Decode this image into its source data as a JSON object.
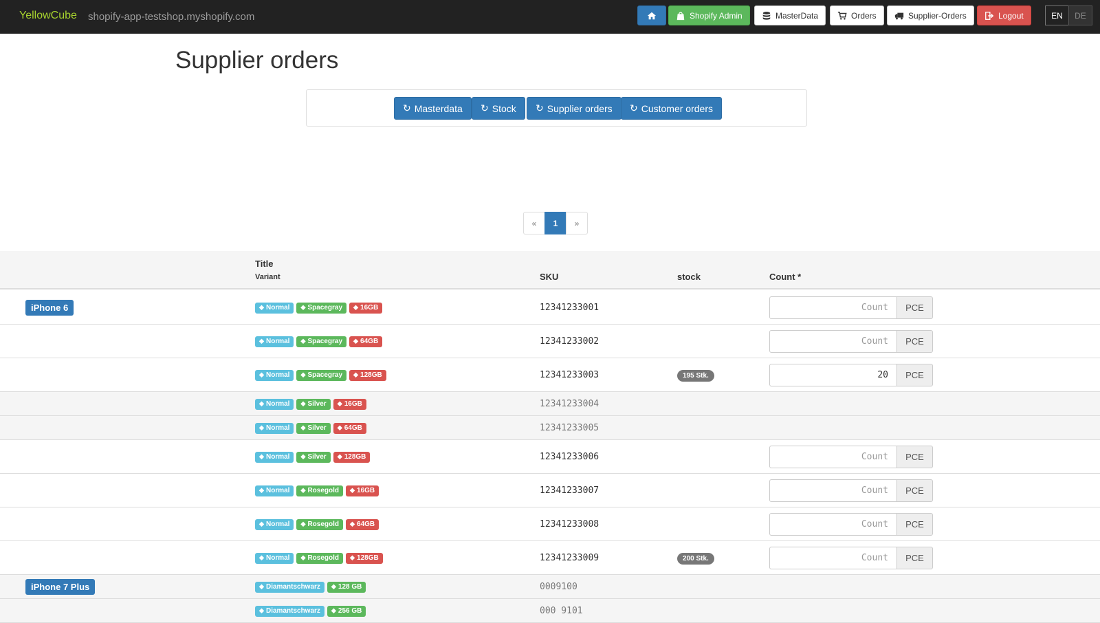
{
  "navbar": {
    "brand": "YellowCube",
    "shop": "shopify-app-testshop.myshopify.com",
    "buttons": {
      "home": "home-icon",
      "shopify_admin": "Shopify Admin",
      "masterdata": "MasterData",
      "orders": "Orders",
      "supplier_orders": "Supplier-Orders",
      "logout": "Logout"
    },
    "lang": {
      "en": "EN",
      "de": "DE"
    }
  },
  "page_title": "Supplier orders",
  "sync": {
    "masterdata": "Masterdata",
    "stock": "Stock",
    "supplier_orders": "Supplier orders",
    "customer_orders": "Customer orders"
  },
  "pagination": {
    "prev": "«",
    "current": "1",
    "next": "»"
  },
  "table": {
    "headers": {
      "title": "Title",
      "variant": "Variant",
      "sku": "SKU",
      "stock": "stock",
      "count": "Count *"
    },
    "count_placeholder": "Count",
    "unit": "PCE",
    "rows": [
      {
        "product": "iPhone 6",
        "tags": [
          "Normal",
          "Spacegray",
          "16GB"
        ],
        "sku": "12341233001",
        "stock": "",
        "count": "",
        "editable": true
      },
      {
        "product": "",
        "tags": [
          "Normal",
          "Spacegray",
          "64GB"
        ],
        "sku": "12341233002",
        "stock": "",
        "count": "",
        "editable": true
      },
      {
        "product": "",
        "tags": [
          "Normal",
          "Spacegray",
          "128GB"
        ],
        "sku": "12341233003",
        "stock": "195 Stk.",
        "count": "20",
        "editable": true
      },
      {
        "product": "",
        "tags": [
          "Normal",
          "Silver",
          "16GB"
        ],
        "sku": "12341233004",
        "stock": "",
        "count": "",
        "editable": false
      },
      {
        "product": "",
        "tags": [
          "Normal",
          "Silver",
          "64GB"
        ],
        "sku": "12341233005",
        "stock": "",
        "count": "",
        "editable": false
      },
      {
        "product": "",
        "tags": [
          "Normal",
          "Silver",
          "128GB"
        ],
        "sku": "12341233006",
        "stock": "",
        "count": "",
        "editable": true
      },
      {
        "product": "",
        "tags": [
          "Normal",
          "Rosegold",
          "16GB"
        ],
        "sku": "12341233007",
        "stock": "",
        "count": "",
        "editable": true
      },
      {
        "product": "",
        "tags": [
          "Normal",
          "Rosegold",
          "64GB"
        ],
        "sku": "12341233008",
        "stock": "",
        "count": "",
        "editable": true
      },
      {
        "product": "",
        "tags": [
          "Normal",
          "Rosegold",
          "128GB"
        ],
        "sku": "12341233009",
        "stock": "200 Stk.",
        "count": "",
        "editable": true
      },
      {
        "product": "iPhone 7 Plus",
        "tags": [
          "Diamantschwarz",
          "128 GB"
        ],
        "sku": "0009100",
        "stock": "",
        "count": "",
        "editable": false
      },
      {
        "product": "",
        "tags": [
          "Diamantschwarz",
          "256 GB"
        ],
        "sku": "000 9101",
        "stock": "",
        "count": "",
        "editable": false
      }
    ]
  }
}
